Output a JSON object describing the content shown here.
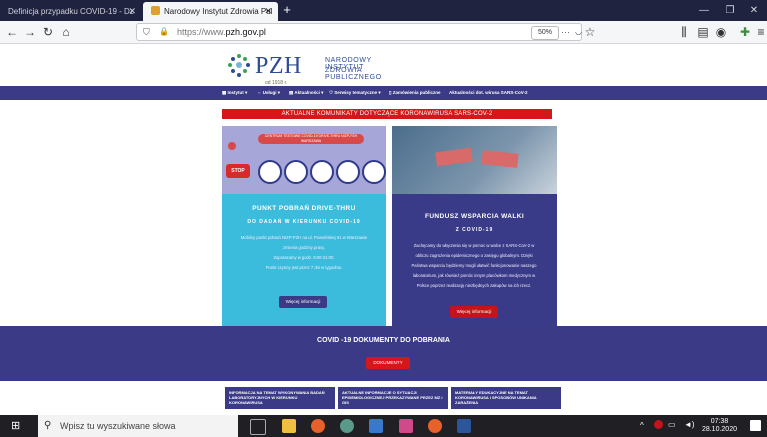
{
  "browser": {
    "tabs": [
      {
        "label": "Definicja przypadku COVID-19 - Dz",
        "active": false
      },
      {
        "label": "Narodowy Instytut Zdrowia Pul",
        "active": true
      }
    ],
    "url_prefix": "https://www.",
    "url_domain": "pzh.gov.pl",
    "zoom": "50%"
  },
  "logo": {
    "abbr": "PZH",
    "line1": "NARODOWY INSTYTUT",
    "line2": "ZDROWIA PUBLICZNEGO",
    "since": "od 1918 r."
  },
  "nav": {
    "items": [
      "Instytut",
      "Usługi",
      "Aktualności",
      "Serwisy tematyczne",
      "Zamówienia publiczne",
      "Aktualności dot. wirusa SARS-CoV-2"
    ]
  },
  "alert": {
    "text": "AKTUALNE KOMUNIKATY DOTYCZĄCE KORONAWIRUSA SARS-COV-2"
  },
  "card1": {
    "banner": "CENTRUM TESTOWE COVID-19 DRIVE-THRU NIZP-PZH WARSZAWA",
    "title": "PUNKT POBRAŃ DRIVE-THRU",
    "subtitle": "DO DADAŃ W KIERUNKU COVID-19",
    "text1": "Mobilny punkt pobrań NIZP-PZH na ul. Powsińskiej 61 w Warszawie",
    "text2": "zmienia godziny pracy.",
    "text3": "Zapraszamy w godz. 9:00-21:00.",
    "text4": "Punkt czynny jest przez 7 dni w tygodniu.",
    "button": "Więcej informacji"
  },
  "card2": {
    "title": "FUNDUSZ WSPARCIA WALKI",
    "subtitle": "Z COVID-19",
    "text1": "Zachęcamy do włączenia się w pomoc w walce z SARS-CoV-2 w",
    "text2": "obliczu zagrożenia epidemicznego o zasięgu globalnym. Dzięki",
    "text3": "Państwa wsparciu będziemy mogli ułatwić funkcjonowanie naszego",
    "text4": "laboratorium, jak również pomóc innym placówkom medycznym w",
    "text5": "Polsce poprzez realizację niezbędnych zakupów na ich rzecz.",
    "button": "Więcej informacji"
  },
  "downloads": {
    "title": "COVID -19 DOKUMENTY DO POBRANIA",
    "button": "DOKUMENTY",
    "docs": [
      "INFORMACJA NA TEMAT WYKONYWANIA BADAŃ LABORATORYJNYCH W KIERUNKU KORONAWIRUSA",
      "AKTUALNE INFORMACJE O SYTUACJI EPIDEMIOLOGICZNEJ PRZEKAZYWANE PRZEZ MZ i GIS",
      "MATERIAŁY EDUKACYJNE NA TEMAT KORONAWIRUSA I SPOSOBÓW UNIKANIA ZARAŻENIA"
    ]
  },
  "taskbar": {
    "search_placeholder": "Wpisz tu wyszukiwane słowa",
    "time": "07:38",
    "date": "28.10.2020"
  }
}
